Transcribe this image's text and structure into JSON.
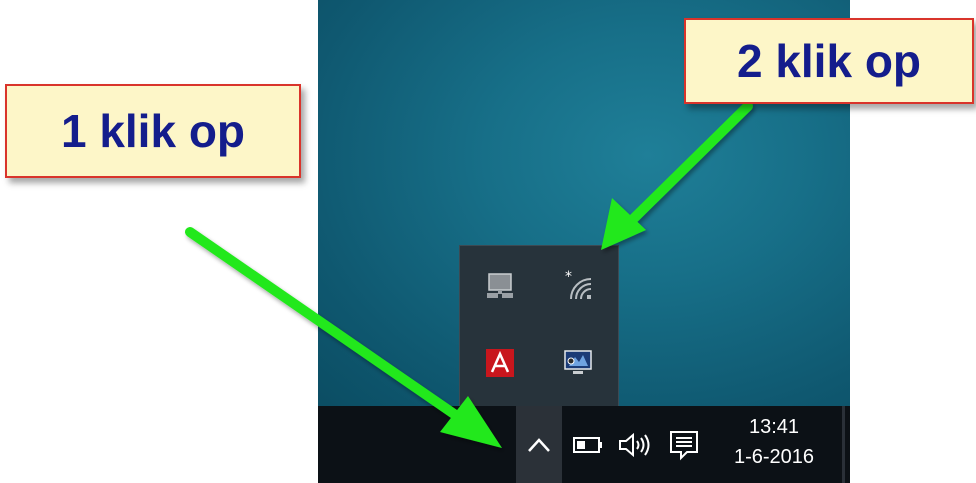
{
  "callouts": {
    "step1": "1 klik op",
    "step2": "2 klik op"
  },
  "taskbar": {
    "show_hidden_icons_icon": "chevron-up-icon",
    "tray_icons": [
      "battery-icon",
      "speaker-icon",
      "action-center-icon"
    ],
    "clock": {
      "time": "13:41",
      "date": "1-6-2016"
    }
  },
  "overflow_tray": {
    "icons": [
      "network-computer-icon",
      "wireless-icon",
      "adobe-icon",
      "display-settings-icon"
    ]
  },
  "colors": {
    "arrow": "#22e81e",
    "callout_text": "#141d8c",
    "callout_border": "#d9342b",
    "callout_bg": "#fdf6c8"
  }
}
